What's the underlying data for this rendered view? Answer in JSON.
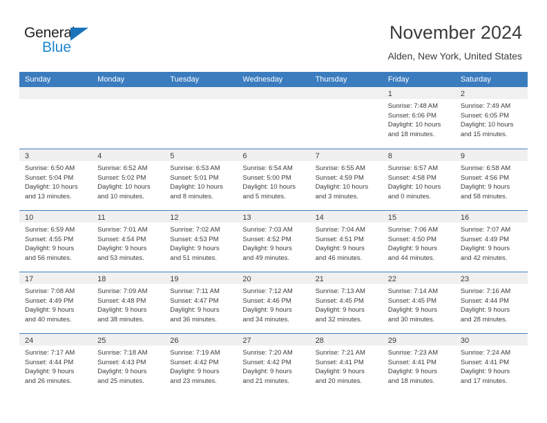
{
  "brand": {
    "name_part1": "General",
    "name_part2": "Blue",
    "triangle_icon": "triangle-icon",
    "accent_color": "#1b86d1",
    "dark_color": "#231f20"
  },
  "header": {
    "title": "November 2024",
    "subtitle": "Alden, New York, United States"
  },
  "calendar": {
    "header_bg": "#3b7cbf",
    "daynum_bg": "#f0f0f0",
    "weekday_labels": [
      "Sunday",
      "Monday",
      "Tuesday",
      "Wednesday",
      "Thursday",
      "Friday",
      "Saturday"
    ],
    "labels": {
      "sunrise": "Sunrise:",
      "sunset": "Sunset:",
      "daylight": "Daylight:"
    },
    "weeks": [
      [
        {
          "day": "",
          "empty": true
        },
        {
          "day": "",
          "empty": true
        },
        {
          "day": "",
          "empty": true
        },
        {
          "day": "",
          "empty": true
        },
        {
          "day": "",
          "empty": true
        },
        {
          "day": "1",
          "sunrise": "Sunrise: 7:48 AM",
          "sunset": "Sunset: 6:06 PM",
          "daylight1": "Daylight: 10 hours",
          "daylight2": "and 18 minutes."
        },
        {
          "day": "2",
          "sunrise": "Sunrise: 7:49 AM",
          "sunset": "Sunset: 6:05 PM",
          "daylight1": "Daylight: 10 hours",
          "daylight2": "and 15 minutes."
        }
      ],
      [
        {
          "day": "3",
          "sunrise": "Sunrise: 6:50 AM",
          "sunset": "Sunset: 5:04 PM",
          "daylight1": "Daylight: 10 hours",
          "daylight2": "and 13 minutes."
        },
        {
          "day": "4",
          "sunrise": "Sunrise: 6:52 AM",
          "sunset": "Sunset: 5:02 PM",
          "daylight1": "Daylight: 10 hours",
          "daylight2": "and 10 minutes."
        },
        {
          "day": "5",
          "sunrise": "Sunrise: 6:53 AM",
          "sunset": "Sunset: 5:01 PM",
          "daylight1": "Daylight: 10 hours",
          "daylight2": "and 8 minutes."
        },
        {
          "day": "6",
          "sunrise": "Sunrise: 6:54 AM",
          "sunset": "Sunset: 5:00 PM",
          "daylight1": "Daylight: 10 hours",
          "daylight2": "and 5 minutes."
        },
        {
          "day": "7",
          "sunrise": "Sunrise: 6:55 AM",
          "sunset": "Sunset: 4:59 PM",
          "daylight1": "Daylight: 10 hours",
          "daylight2": "and 3 minutes."
        },
        {
          "day": "8",
          "sunrise": "Sunrise: 6:57 AM",
          "sunset": "Sunset: 4:58 PM",
          "daylight1": "Daylight: 10 hours",
          "daylight2": "and 0 minutes."
        },
        {
          "day": "9",
          "sunrise": "Sunrise: 6:58 AM",
          "sunset": "Sunset: 4:56 PM",
          "daylight1": "Daylight: 9 hours",
          "daylight2": "and 58 minutes."
        }
      ],
      [
        {
          "day": "10",
          "sunrise": "Sunrise: 6:59 AM",
          "sunset": "Sunset: 4:55 PM",
          "daylight1": "Daylight: 9 hours",
          "daylight2": "and 56 minutes."
        },
        {
          "day": "11",
          "sunrise": "Sunrise: 7:01 AM",
          "sunset": "Sunset: 4:54 PM",
          "daylight1": "Daylight: 9 hours",
          "daylight2": "and 53 minutes."
        },
        {
          "day": "12",
          "sunrise": "Sunrise: 7:02 AM",
          "sunset": "Sunset: 4:53 PM",
          "daylight1": "Daylight: 9 hours",
          "daylight2": "and 51 minutes."
        },
        {
          "day": "13",
          "sunrise": "Sunrise: 7:03 AM",
          "sunset": "Sunset: 4:52 PM",
          "daylight1": "Daylight: 9 hours",
          "daylight2": "and 49 minutes."
        },
        {
          "day": "14",
          "sunrise": "Sunrise: 7:04 AM",
          "sunset": "Sunset: 4:51 PM",
          "daylight1": "Daylight: 9 hours",
          "daylight2": "and 46 minutes."
        },
        {
          "day": "15",
          "sunrise": "Sunrise: 7:06 AM",
          "sunset": "Sunset: 4:50 PM",
          "daylight1": "Daylight: 9 hours",
          "daylight2": "and 44 minutes."
        },
        {
          "day": "16",
          "sunrise": "Sunrise: 7:07 AM",
          "sunset": "Sunset: 4:49 PM",
          "daylight1": "Daylight: 9 hours",
          "daylight2": "and 42 minutes."
        }
      ],
      [
        {
          "day": "17",
          "sunrise": "Sunrise: 7:08 AM",
          "sunset": "Sunset: 4:49 PM",
          "daylight1": "Daylight: 9 hours",
          "daylight2": "and 40 minutes."
        },
        {
          "day": "18",
          "sunrise": "Sunrise: 7:09 AM",
          "sunset": "Sunset: 4:48 PM",
          "daylight1": "Daylight: 9 hours",
          "daylight2": "and 38 minutes."
        },
        {
          "day": "19",
          "sunrise": "Sunrise: 7:11 AM",
          "sunset": "Sunset: 4:47 PM",
          "daylight1": "Daylight: 9 hours",
          "daylight2": "and 36 minutes."
        },
        {
          "day": "20",
          "sunrise": "Sunrise: 7:12 AM",
          "sunset": "Sunset: 4:46 PM",
          "daylight1": "Daylight: 9 hours",
          "daylight2": "and 34 minutes."
        },
        {
          "day": "21",
          "sunrise": "Sunrise: 7:13 AM",
          "sunset": "Sunset: 4:45 PM",
          "daylight1": "Daylight: 9 hours",
          "daylight2": "and 32 minutes."
        },
        {
          "day": "22",
          "sunrise": "Sunrise: 7:14 AM",
          "sunset": "Sunset: 4:45 PM",
          "daylight1": "Daylight: 9 hours",
          "daylight2": "and 30 minutes."
        },
        {
          "day": "23",
          "sunrise": "Sunrise: 7:16 AM",
          "sunset": "Sunset: 4:44 PM",
          "daylight1": "Daylight: 9 hours",
          "daylight2": "and 28 minutes."
        }
      ],
      [
        {
          "day": "24",
          "sunrise": "Sunrise: 7:17 AM",
          "sunset": "Sunset: 4:44 PM",
          "daylight1": "Daylight: 9 hours",
          "daylight2": "and 26 minutes."
        },
        {
          "day": "25",
          "sunrise": "Sunrise: 7:18 AM",
          "sunset": "Sunset: 4:43 PM",
          "daylight1": "Daylight: 9 hours",
          "daylight2": "and 25 minutes."
        },
        {
          "day": "26",
          "sunrise": "Sunrise: 7:19 AM",
          "sunset": "Sunset: 4:42 PM",
          "daylight1": "Daylight: 9 hours",
          "daylight2": "and 23 minutes."
        },
        {
          "day": "27",
          "sunrise": "Sunrise: 7:20 AM",
          "sunset": "Sunset: 4:42 PM",
          "daylight1": "Daylight: 9 hours",
          "daylight2": "and 21 minutes."
        },
        {
          "day": "28",
          "sunrise": "Sunrise: 7:21 AM",
          "sunset": "Sunset: 4:41 PM",
          "daylight1": "Daylight: 9 hours",
          "daylight2": "and 20 minutes."
        },
        {
          "day": "29",
          "sunrise": "Sunrise: 7:23 AM",
          "sunset": "Sunset: 4:41 PM",
          "daylight1": "Daylight: 9 hours",
          "daylight2": "and 18 minutes."
        },
        {
          "day": "30",
          "sunrise": "Sunrise: 7:24 AM",
          "sunset": "Sunset: 4:41 PM",
          "daylight1": "Daylight: 9 hours",
          "daylight2": "and 17 minutes."
        }
      ]
    ]
  }
}
